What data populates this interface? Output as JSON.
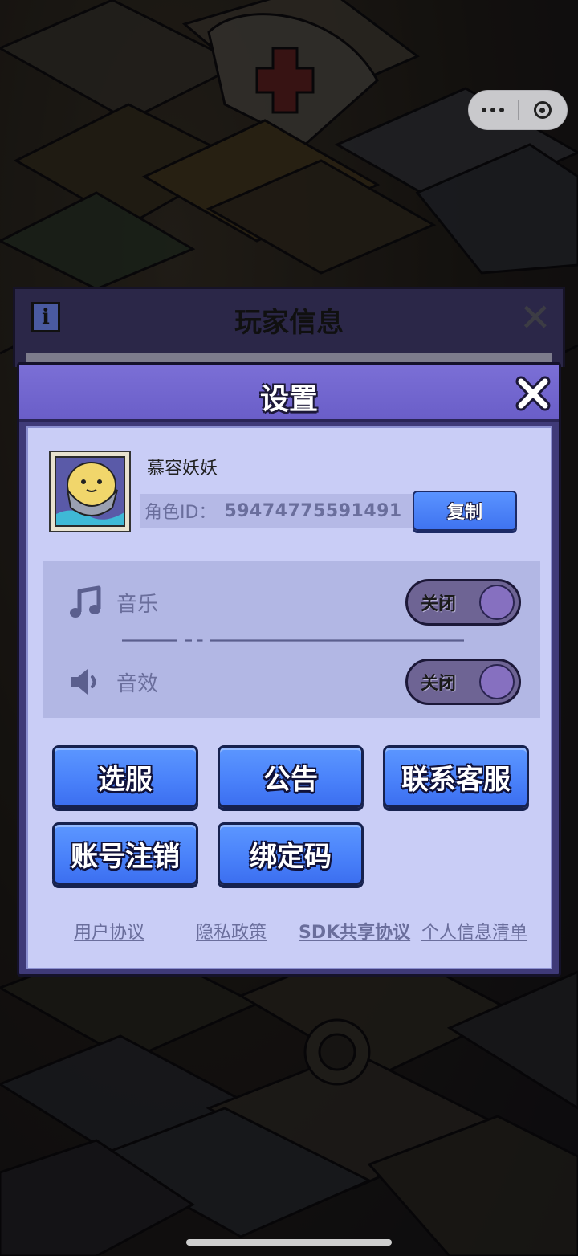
{
  "capsule": {
    "more_icon": "more-dots-icon",
    "close_icon": "target-close-icon"
  },
  "background_panel": {
    "title": "玩家信息",
    "icon_letter": "i"
  },
  "settings": {
    "title": "设置",
    "profile": {
      "nickname": "慕容妖妖",
      "id_label": "角色ID：",
      "id_value": "59474775591491",
      "copy_label": "复制"
    },
    "music": {
      "label": "音乐",
      "toggle_label": "关闭",
      "icon": "music-note-icon"
    },
    "sfx": {
      "label": "音效",
      "toggle_label": "关闭",
      "icon": "speaker-icon"
    },
    "buttons": [
      "选服",
      "公告",
      "联系客服",
      "账号注销",
      "绑定码"
    ],
    "links": [
      "用户协议",
      "隐私政策",
      "SDK共享协议",
      "个人信息清单"
    ]
  },
  "colors": {
    "header": "#6a5ec8",
    "body": "#c9cdf6",
    "button_blue": "#4a82fa",
    "toggle_off": "#6e6494",
    "link": "#6a6e9c"
  }
}
